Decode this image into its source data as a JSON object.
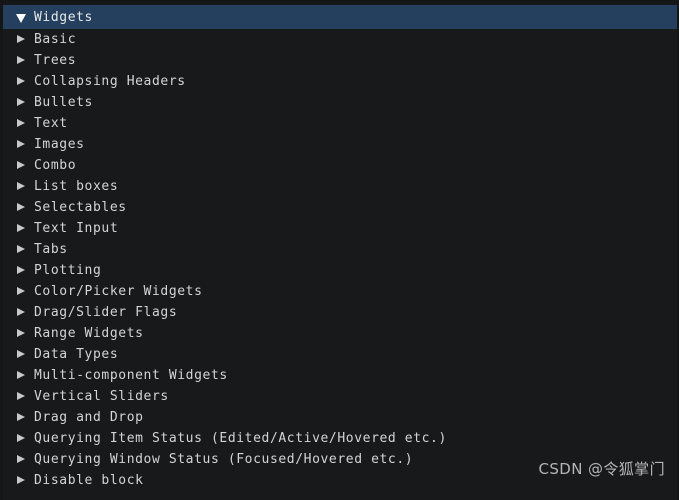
{
  "window": {
    "title": "Widgets",
    "background_color": "#17191b",
    "frame_color": "#131517",
    "selected_header_color": "#24405e",
    "text_color": "#d4d4d4",
    "arrow_color": "#c9c9c9"
  },
  "tree": {
    "root": {
      "label": "Widgets",
      "expanded": true,
      "arrow_icon": "triangle-down-icon"
    },
    "items": [
      {
        "label": "Basic",
        "arrow_icon": "triangle-right-icon",
        "expanded": false
      },
      {
        "label": "Trees",
        "arrow_icon": "triangle-right-icon",
        "expanded": false
      },
      {
        "label": "Collapsing Headers",
        "arrow_icon": "triangle-right-icon",
        "expanded": false
      },
      {
        "label": "Bullets",
        "arrow_icon": "triangle-right-icon",
        "expanded": false
      },
      {
        "label": "Text",
        "arrow_icon": "triangle-right-icon",
        "expanded": false
      },
      {
        "label": "Images",
        "arrow_icon": "triangle-right-icon",
        "expanded": false
      },
      {
        "label": "Combo",
        "arrow_icon": "triangle-right-icon",
        "expanded": false
      },
      {
        "label": "List boxes",
        "arrow_icon": "triangle-right-icon",
        "expanded": false
      },
      {
        "label": "Selectables",
        "arrow_icon": "triangle-right-icon",
        "expanded": false
      },
      {
        "label": "Text Input",
        "arrow_icon": "triangle-right-icon",
        "expanded": false
      },
      {
        "label": "Tabs",
        "arrow_icon": "triangle-right-icon",
        "expanded": false
      },
      {
        "label": "Plotting",
        "arrow_icon": "triangle-right-icon",
        "expanded": false
      },
      {
        "label": "Color/Picker Widgets",
        "arrow_icon": "triangle-right-icon",
        "expanded": false
      },
      {
        "label": "Drag/Slider Flags",
        "arrow_icon": "triangle-right-icon",
        "expanded": false
      },
      {
        "label": "Range Widgets",
        "arrow_icon": "triangle-right-icon",
        "expanded": false
      },
      {
        "label": "Data Types",
        "arrow_icon": "triangle-right-icon",
        "expanded": false
      },
      {
        "label": "Multi-component Widgets",
        "arrow_icon": "triangle-right-icon",
        "expanded": false
      },
      {
        "label": "Vertical Sliders",
        "arrow_icon": "triangle-right-icon",
        "expanded": false
      },
      {
        "label": "Drag and Drop",
        "arrow_icon": "triangle-right-icon",
        "expanded": false
      },
      {
        "label": "Querying Item Status (Edited/Active/Hovered etc.)",
        "arrow_icon": "triangle-right-icon",
        "expanded": false
      },
      {
        "label": "Querying Window Status (Focused/Hovered etc.)",
        "arrow_icon": "triangle-right-icon",
        "expanded": false
      },
      {
        "label": "Disable block",
        "arrow_icon": "triangle-right-icon",
        "expanded": false
      }
    ]
  },
  "watermark": {
    "text": "CSDN @令狐掌门"
  }
}
